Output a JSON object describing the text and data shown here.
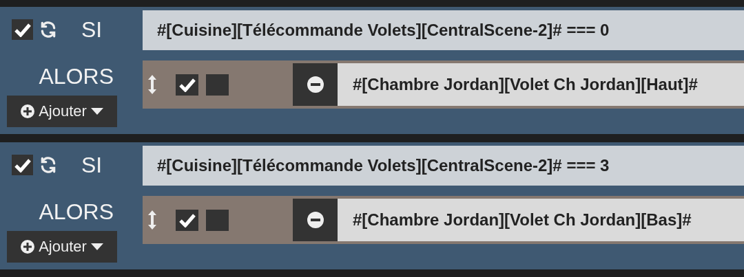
{
  "rules": [
    {
      "enabled": true,
      "label_if": "SI",
      "condition": "#[Cuisine][Télécommande Volets][CentralScene-2]# === 0",
      "label_then": "ALORS",
      "add_button": "Ajouter",
      "actions": [
        {
          "enabled": true,
          "option": false,
          "expression": "#[Chambre Jordan][Volet Ch Jordan][Haut]#"
        }
      ]
    },
    {
      "enabled": true,
      "label_if": "SI",
      "condition": "#[Cuisine][Télécommande Volets][CentralScene-2]# === 3",
      "label_then": "ALORS",
      "add_button": "Ajouter",
      "actions": [
        {
          "enabled": true,
          "option": false,
          "expression": "#[Chambre Jordan][Volet Ch Jordan][Bas]#"
        }
      ]
    }
  ]
}
